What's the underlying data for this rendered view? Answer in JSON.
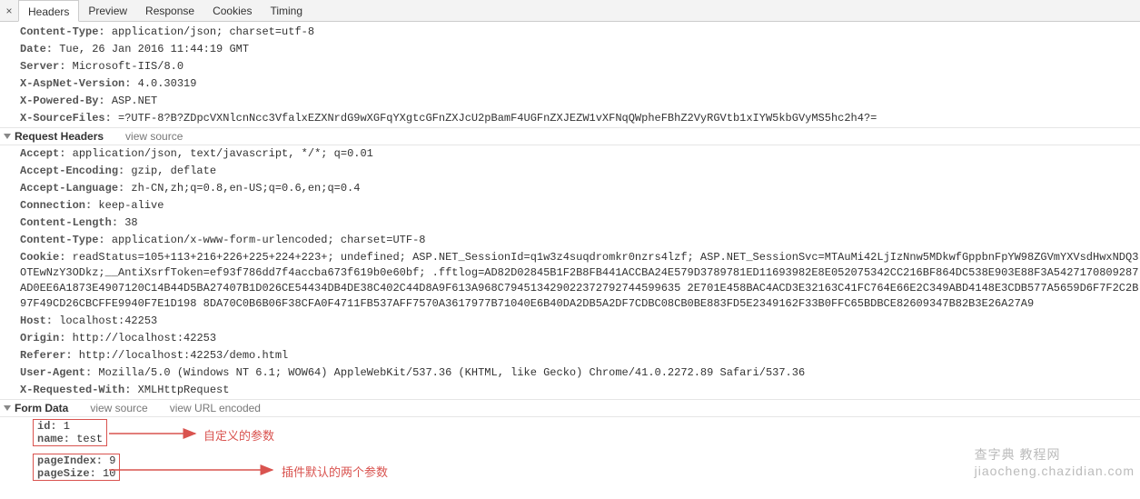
{
  "tabs": {
    "close": "×",
    "items": [
      "Headers",
      "Preview",
      "Response",
      "Cookies",
      "Timing"
    ],
    "activeIndex": 0
  },
  "responseHeaders": [
    {
      "k": "Content-Type",
      "v": "application/json; charset=utf-8"
    },
    {
      "k": "Date",
      "v": "Tue, 26 Jan 2016 11:44:19 GMT"
    },
    {
      "k": "Server",
      "v": "Microsoft-IIS/8.0"
    },
    {
      "k": "X-AspNet-Version",
      "v": "4.0.30319"
    },
    {
      "k": "X-Powered-By",
      "v": "ASP.NET"
    },
    {
      "k": "X-SourceFiles",
      "v": "=?UTF-8?B?ZDpcVXNlcnNcc3VfalxEZXNrdG9wXGFqYXgtcGFnZXJcU2pBamF4UGFnZXJEZW1vXFNqQWpheFBhZ2VyRGVtb1xIYW5kbGVyMS5hc2h4?="
    }
  ],
  "sections": {
    "requestHeaders": "Request Headers",
    "formData": "Form Data",
    "viewSource": "view source",
    "viewUrlEncoded": "view URL encoded"
  },
  "requestHeaders": [
    {
      "k": "Accept",
      "v": "application/json, text/javascript, */*; q=0.01"
    },
    {
      "k": "Accept-Encoding",
      "v": "gzip, deflate"
    },
    {
      "k": "Accept-Language",
      "v": "zh-CN,zh;q=0.8,en-US;q=0.6,en;q=0.4"
    },
    {
      "k": "Connection",
      "v": "keep-alive"
    },
    {
      "k": "Content-Length",
      "v": "38"
    },
    {
      "k": "Content-Type",
      "v": "application/x-www-form-urlencoded; charset=UTF-8"
    },
    {
      "k": "Cookie",
      "v": "readStatus=105+113+216+226+225+224+223+; undefined; ASP.NET_SessionId=q1w3z4suqdromkr0nzrs4lzf; ASP.NET_SessionSvc=MTAuMi42LjIzNnw5MDkwfGppbnFpYW98ZGVmYXVsdHwxNDQ3OTEwNzY3ODkz;__AntiXsrfToken=ef93f786dd7f4accba673f619b0e60bf; .fftlog=AD82D02845B1F2B8FB441ACCBA24E579D3789781ED11693982E8E052075342CC216BF864DC538E903E88F3A5427170809287AD0EE6A1873E4907120C14B44D5BA27407B1D026CE54434DB4DE38C402C44D8A9F613A968C794513429022372792744599635 2E701E458BAC4ACD3E32163C41FC764E66E2C349ABD4148E3CDB577A5659D6F7F2C2B97F49CD26CBCFFE9940F7E1D198 8DA70C0B6B06F38CFA0F4711FB537AFF7570A3617977B71040E6B40DA2DB5A2DF7CDBC08CB0BE883FD5E2349162F33B0FFC65BDBCE82609347B82B3E26A27A9"
    },
    {
      "k": "Host",
      "v": "localhost:42253"
    },
    {
      "k": "Origin",
      "v": "http://localhost:42253"
    },
    {
      "k": "Referer",
      "v": "http://localhost:42253/demo.html"
    },
    {
      "k": "User-Agent",
      "v": "Mozilla/5.0 (Windows NT 6.1; WOW64) AppleWebKit/537.36 (KHTML, like Gecko) Chrome/41.0.2272.89 Safari/537.36"
    },
    {
      "k": "X-Requested-With",
      "v": "XMLHttpRequest"
    }
  ],
  "formData": {
    "box1": [
      {
        "k": "id",
        "v": "1"
      },
      {
        "k": "name",
        "v": "test"
      }
    ],
    "box2": [
      {
        "k": "pageIndex",
        "v": "9"
      },
      {
        "k": "pageSize",
        "v": "10"
      }
    ]
  },
  "annotations": {
    "custom": "自定义的参数",
    "default": "插件默认的两个参数"
  },
  "watermark": "查字典 教程网\njiaocheng.chazidian.com",
  "colors": {
    "annotation": "#d9534f"
  }
}
